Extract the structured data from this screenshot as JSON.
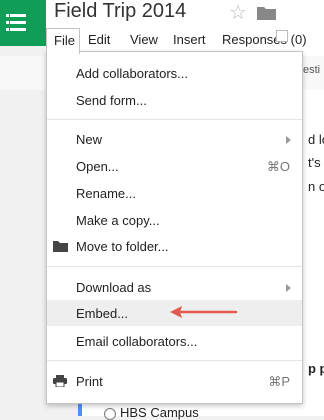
{
  "app": {
    "title": "Field Trip 2014",
    "star": "☆",
    "accent_color": "#0f9d58"
  },
  "menubar": {
    "file": "File",
    "edit": "Edit",
    "view": "View",
    "insert": "Insert",
    "responses": "Responses (0)"
  },
  "background": {
    "toolbar_fragment": "esti",
    "line1": "d lo",
    "line2": "t's C",
    "line3": "n of",
    "question_fragment": "p pi",
    "radio_option": "HBS Campus"
  },
  "file_menu": {
    "add_collaborators": "Add collaborators...",
    "send_form": "Send form...",
    "new": "New",
    "open": "Open...",
    "open_shortcut": "⌘O",
    "rename": "Rename...",
    "make_copy": "Make a copy...",
    "move_to_folder": "Move to folder...",
    "download_as": "Download as",
    "embed": "Embed...",
    "email_collaborators": "Email collaborators...",
    "print": "Print",
    "print_shortcut": "⌘P"
  },
  "colors": {
    "highlight": "#eeeeee",
    "annotation_arrow": "#e05a4e",
    "sheet_accent": "#4d90fe"
  }
}
